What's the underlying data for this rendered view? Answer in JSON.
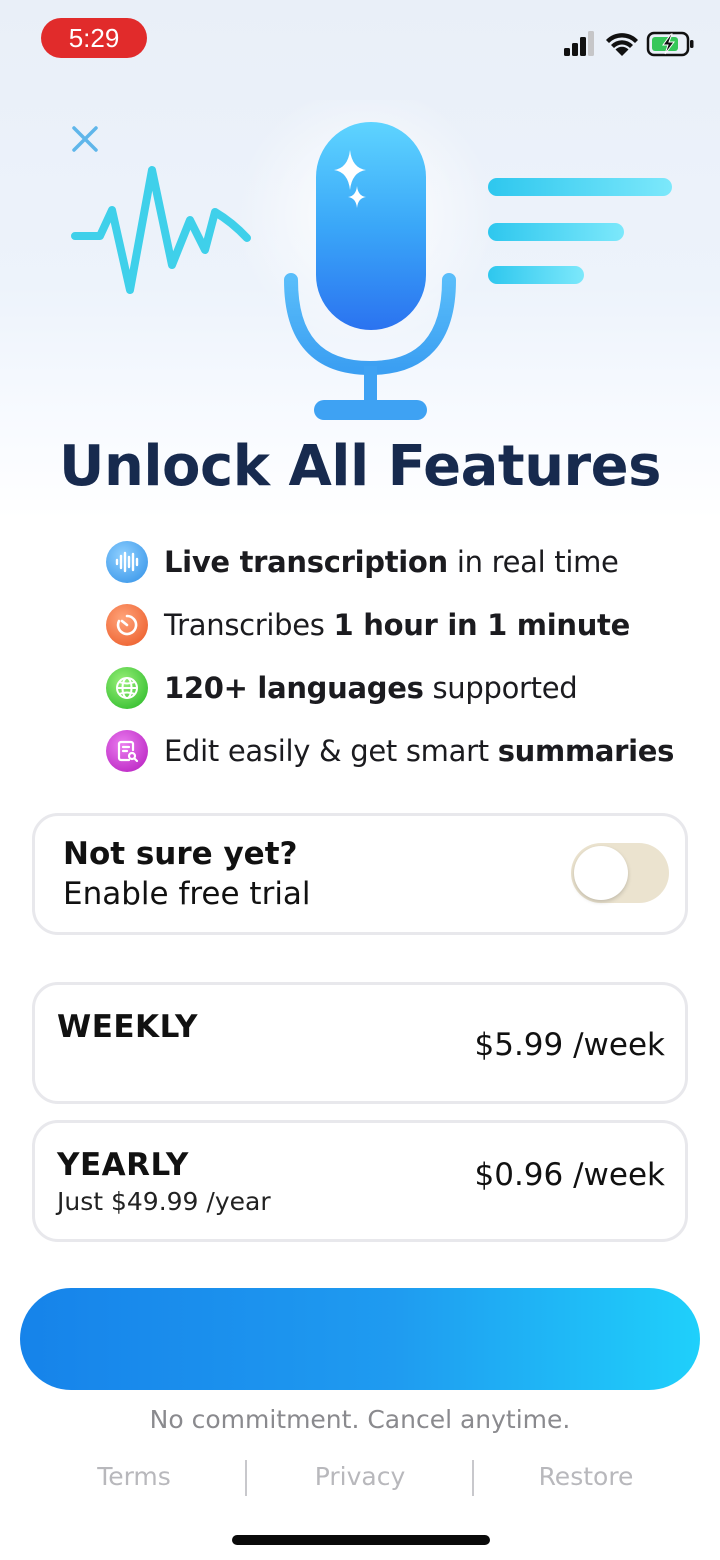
{
  "status_bar": {
    "time": "5:29",
    "time_pill_color": "#e12b2b"
  },
  "icons": {
    "close": "close-icon",
    "signal": "cellular-signal-icon",
    "wifi": "wifi-icon",
    "battery": "battery-charging-icon",
    "microphone": "microphone-icon",
    "waveform": "waveform-icon",
    "text_lines": "text-lines-icon"
  },
  "title": "Unlock All Features",
  "features": [
    {
      "icon": "soundwave-icon",
      "color": "#2f9be8",
      "bold": "Live transcription",
      "rest": " in real time"
    },
    {
      "icon": "timer-icon",
      "color": "#f2652e",
      "pre": "Transcribes ",
      "bold": "1 hour in 1 minute"
    },
    {
      "icon": "globe-icon",
      "color": "#2fc12f",
      "bold": "120+ languages",
      "rest": " supported"
    },
    {
      "icon": "document-search-icon",
      "color": "#c02cc6",
      "pre": "Edit easily & get smart ",
      "bold": "summaries"
    }
  ],
  "trial": {
    "line1": "Not sure yet?",
    "line2": "Enable free trial",
    "enabled": false
  },
  "plans": {
    "weekly": {
      "name": "WEEKLY",
      "price": "$5.99 /week"
    },
    "yearly": {
      "name": "YEARLY",
      "subtitle": "Just $49.99 /year",
      "price": "$0.96 /week"
    }
  },
  "cta": {
    "label": ""
  },
  "no_commitment": "No commitment. Cancel anytime.",
  "footer": {
    "terms": "Terms",
    "privacy": "Privacy",
    "restore": "Restore"
  },
  "colors": {
    "accent": "#1f9bf0",
    "title": "#172a4e",
    "toggle_off": "#ebe3cf"
  }
}
